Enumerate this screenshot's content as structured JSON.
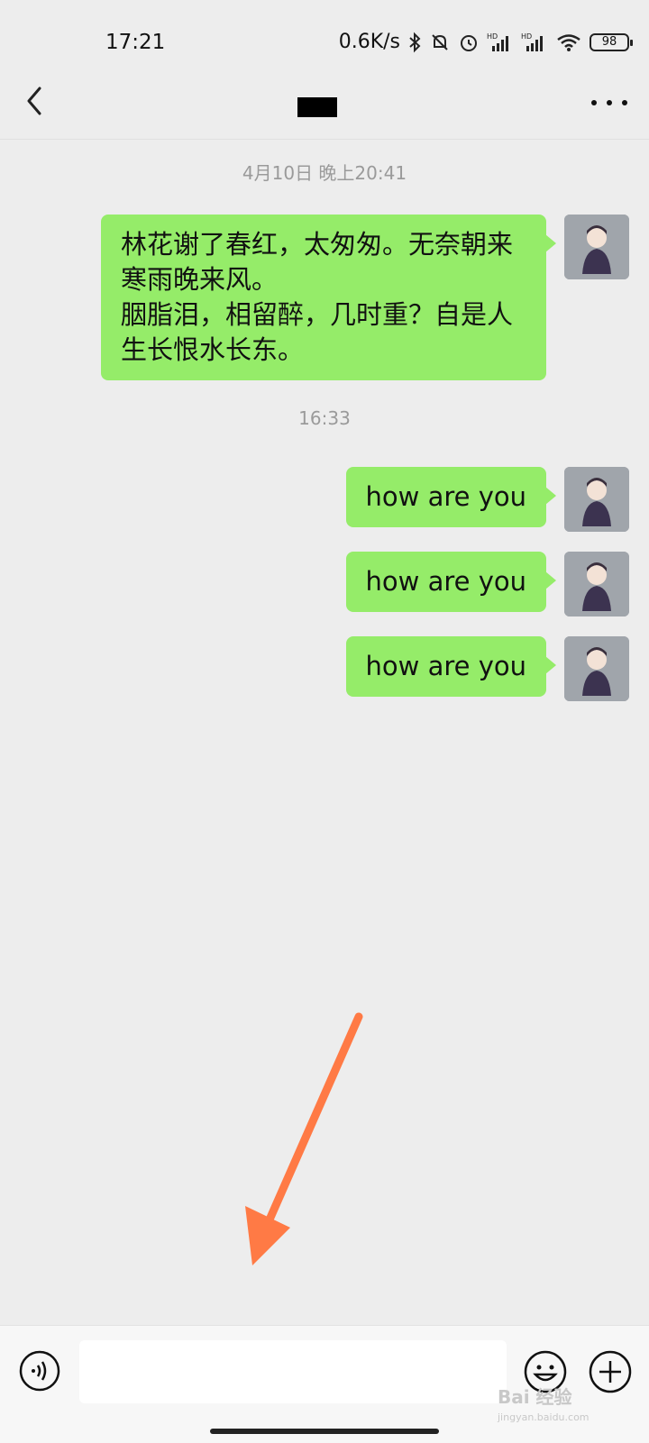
{
  "status_bar": {
    "time": "17:21",
    "network_speed": "0.6K/s",
    "battery": "98",
    "icons": [
      "bluetooth-icon",
      "mute-icon",
      "alarm-icon",
      "signal-hd-icon",
      "signal-hd-icon",
      "wifi-icon",
      "battery-icon"
    ]
  },
  "header": {
    "back_icon": "chevron-left-icon",
    "more_icon": "more-dots-icon"
  },
  "chat": {
    "timestamps": [
      "4月10日 晚上20:41",
      "16:33"
    ],
    "messages": [
      {
        "text": "林花谢了春红，太匆匆。无奈朝来寒雨晚来风。\n胭脂泪，相留醉，几时重？自是人生长恨水长东。",
        "sender": "me"
      },
      {
        "text": "how are you",
        "sender": "me"
      },
      {
        "text": "how are you",
        "sender": "me"
      },
      {
        "text": "how are you",
        "sender": "me"
      }
    ]
  },
  "input_bar": {
    "text_value": "",
    "voice_icon": "voice-icon",
    "emoji_icon": "emoji-icon",
    "plus_icon": "plus-icon"
  },
  "watermark": {
    "main": "Bai 经验",
    "sub": "jingyan.baidu.com"
  },
  "colors": {
    "bubble": "#95ec69",
    "background": "#ededed",
    "arrow": "#ff7a45"
  }
}
